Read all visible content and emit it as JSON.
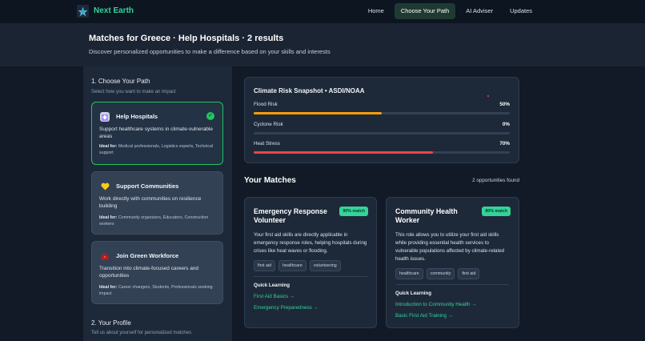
{
  "nav": {
    "brand": "Next Earth",
    "links": [
      "Home",
      "Choose Your Path",
      "AI Adviser",
      "Updates"
    ],
    "active_index": 1
  },
  "hero": {
    "title": "Matches for Greece · Help Hospitals · 2 results",
    "subtitle": "Discover personalized opportunities to make a difference based on your skills and interests"
  },
  "sidebar": {
    "section1_title": "1. Choose Your Path",
    "section1_subtitle": "Select how you want to make an impact",
    "paths": [
      {
        "icon": "hospital-icon",
        "title": "Help Hospitals",
        "desc": "Support healthcare systems in climate-vulnerable areas",
        "ideal_label": "Ideal for:",
        "ideal": "Medical professionals, Logistics experts, Technical support",
        "selected": true
      },
      {
        "icon": "heart-icon",
        "title": "Support Communities",
        "desc": "Work directly with communities on resilience building",
        "ideal_label": "Ideal for:",
        "ideal": "Community organizers, Educators, Construction workers",
        "selected": false
      },
      {
        "icon": "briefcase-icon",
        "title": "Join Green Workforce",
        "desc": "Transition into climate-focused careers and opportunities",
        "ideal_label": "Ideal for:",
        "ideal": "Career changers, Students, Professionals seeking impact",
        "selected": false
      }
    ],
    "section2_title": "2. Your Profile",
    "section2_subtitle": "Tell us about yourself for personalized matches"
  },
  "snapshot": {
    "title": "Climate Risk Snapshot • ASDI/NOAA",
    "risks": [
      {
        "label": "Flood Risk",
        "value": "50%",
        "fraction": 0.5,
        "color": "#f59e0b"
      },
      {
        "label": "Cyclone Risk",
        "value": "0%",
        "fraction": 0.0,
        "color": "#3b82f6"
      },
      {
        "label": "Heat Stress",
        "value": "70%",
        "fraction": 0.7,
        "color": "#ef4444"
      }
    ]
  },
  "matches": {
    "title": "Your Matches",
    "count": "2 opportunities found",
    "quick_learning_label": "Quick Learning",
    "items": [
      {
        "title": "Emergency Response Volunteer",
        "badge": "90% match",
        "desc": "Your first aid skills are directly applicable in emergency response roles, helping hospitals during crises like heat waves or flooding.",
        "tags": [
          "first aid",
          "healthcare",
          "volunteering"
        ],
        "links": [
          "First Aid Basics →",
          "Emergency Preparedness →"
        ]
      },
      {
        "title": "Community Health Worker",
        "badge": "80% match",
        "desc": "This role allows you to utilize your first aid skills while providing essential health services to vulnerable populations affected by climate-related health issues.",
        "tags": [
          "healthcare",
          "community",
          "first aid"
        ],
        "links": [
          "Introduction to Community Health →",
          "Basic First Aid Training →"
        ]
      }
    ]
  }
}
